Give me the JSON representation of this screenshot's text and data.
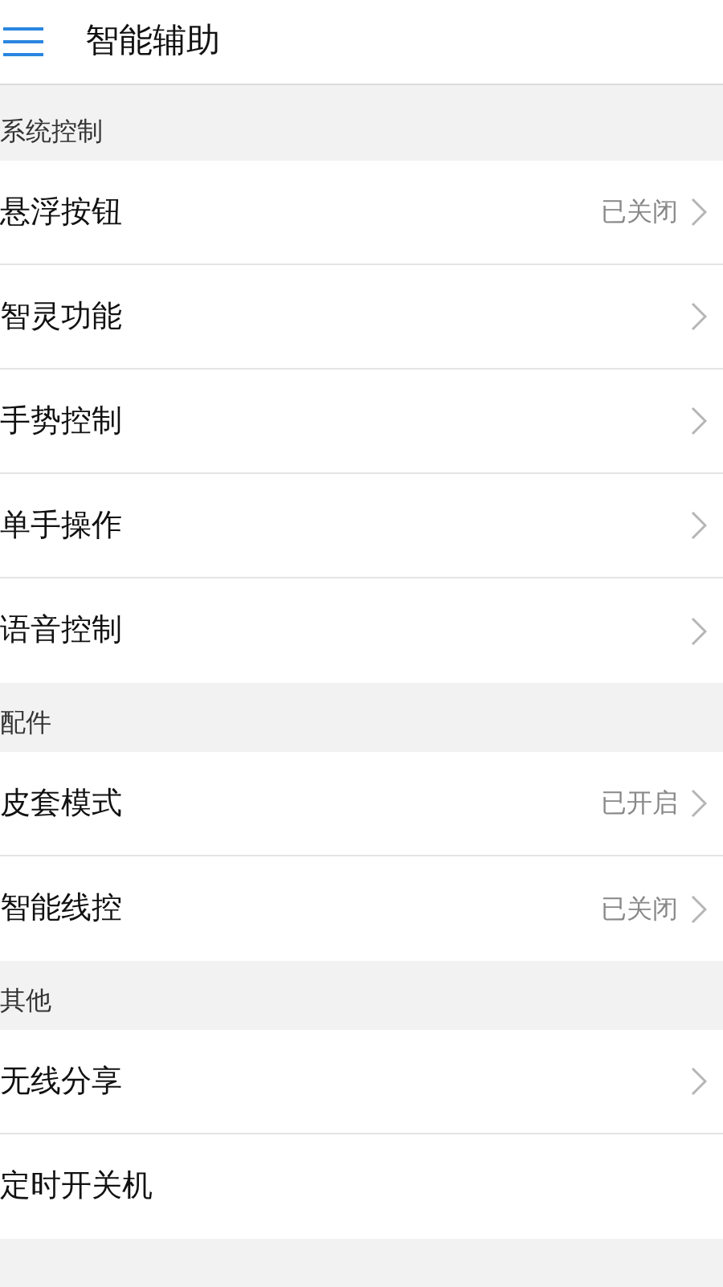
{
  "header": {
    "title": "智能辅助"
  },
  "sections": [
    {
      "title": "系统控制",
      "items": [
        {
          "label": "悬浮按钮",
          "value": "已关闭",
          "chevron": true
        },
        {
          "label": "智灵功能",
          "chevron": true
        },
        {
          "label": "手势控制",
          "chevron": true
        },
        {
          "label": "单手操作",
          "chevron": true
        },
        {
          "label": "语音控制",
          "chevron": true
        }
      ]
    },
    {
      "title": "配件",
      "items": [
        {
          "label": "皮套模式",
          "value": "已开启",
          "chevron": true
        },
        {
          "label": "智能线控",
          "value": "已关闭",
          "chevron": true
        }
      ]
    },
    {
      "title": "其他",
      "items": [
        {
          "label": "无线分享",
          "chevron": true
        },
        {
          "label": "定时开关机",
          "chevron": false
        }
      ]
    }
  ]
}
